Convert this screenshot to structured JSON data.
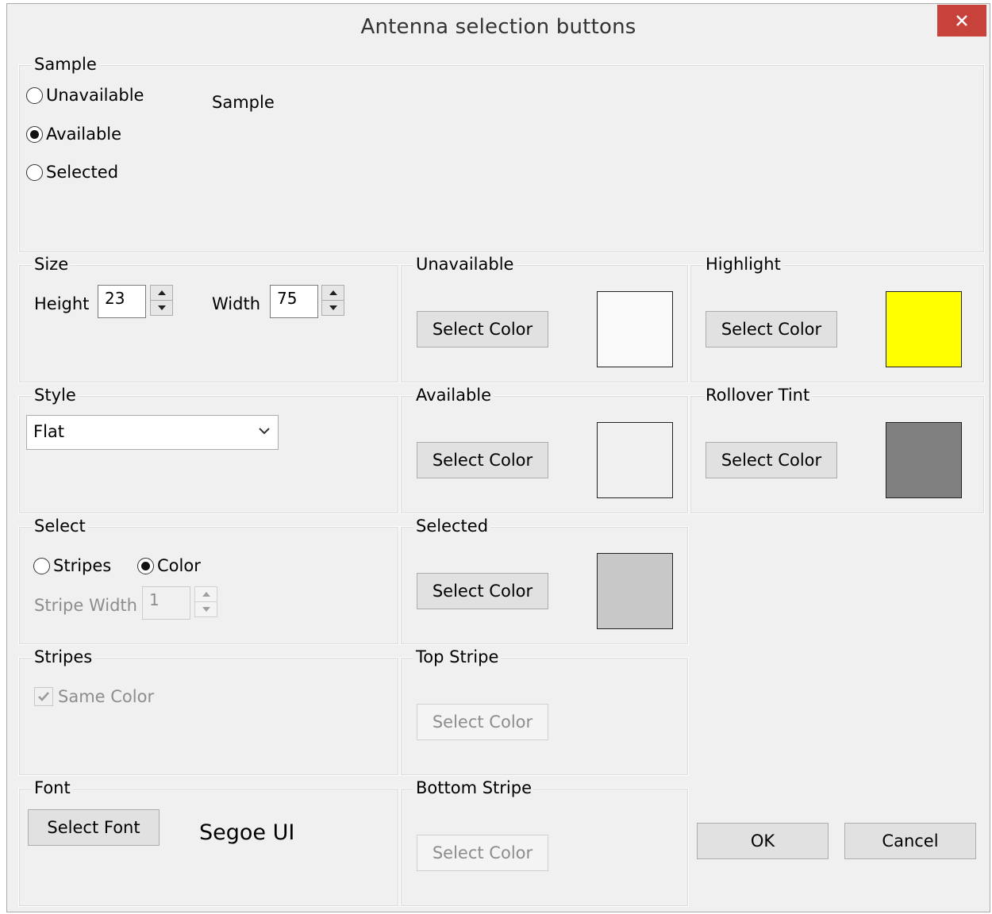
{
  "window": {
    "title": "Antenna selection buttons",
    "close_icon": "close-icon"
  },
  "sample": {
    "legend": "Sample",
    "options": [
      "Unavailable",
      "Available",
      "Selected"
    ],
    "selected_option": "Available",
    "preview_label": "Sample"
  },
  "size": {
    "legend": "Size",
    "height_label": "Height",
    "height_value": "23",
    "width_label": "Width",
    "width_value": "75"
  },
  "style": {
    "legend": "Style",
    "selected": "Flat"
  },
  "select": {
    "legend": "Select",
    "stripes_label": "Stripes",
    "color_label": "Color",
    "selected_option": "Color",
    "stripe_width_label": "Stripe Width",
    "stripe_width_value": "1"
  },
  "stripes": {
    "legend": "Stripes",
    "same_color_label": "Same Color",
    "same_color_checked": true
  },
  "font": {
    "legend": "Font",
    "button_label": "Select Font",
    "font_name": "Segoe UI"
  },
  "color_groups": {
    "unavailable": {
      "legend": "Unavailable",
      "button": "Select Color",
      "swatch": "#f9f9f9"
    },
    "available": {
      "legend": "Available",
      "button": "Select Color",
      "swatch": "#f0f0f0"
    },
    "selected": {
      "legend": "Selected",
      "button": "Select Color",
      "swatch": "#c8c8c8"
    },
    "top_stripe": {
      "legend": "Top Stripe",
      "button": "Select Color"
    },
    "bottom_stripe": {
      "legend": "Bottom Stripe",
      "button": "Select Color"
    },
    "highlight": {
      "legend": "Highlight",
      "button": "Select Color",
      "swatch": "#ffff00"
    },
    "rollover_tint": {
      "legend": "Rollover Tint",
      "button": "Select Color",
      "swatch": "#808080"
    }
  },
  "actions": {
    "ok": "OK",
    "cancel": "Cancel"
  }
}
